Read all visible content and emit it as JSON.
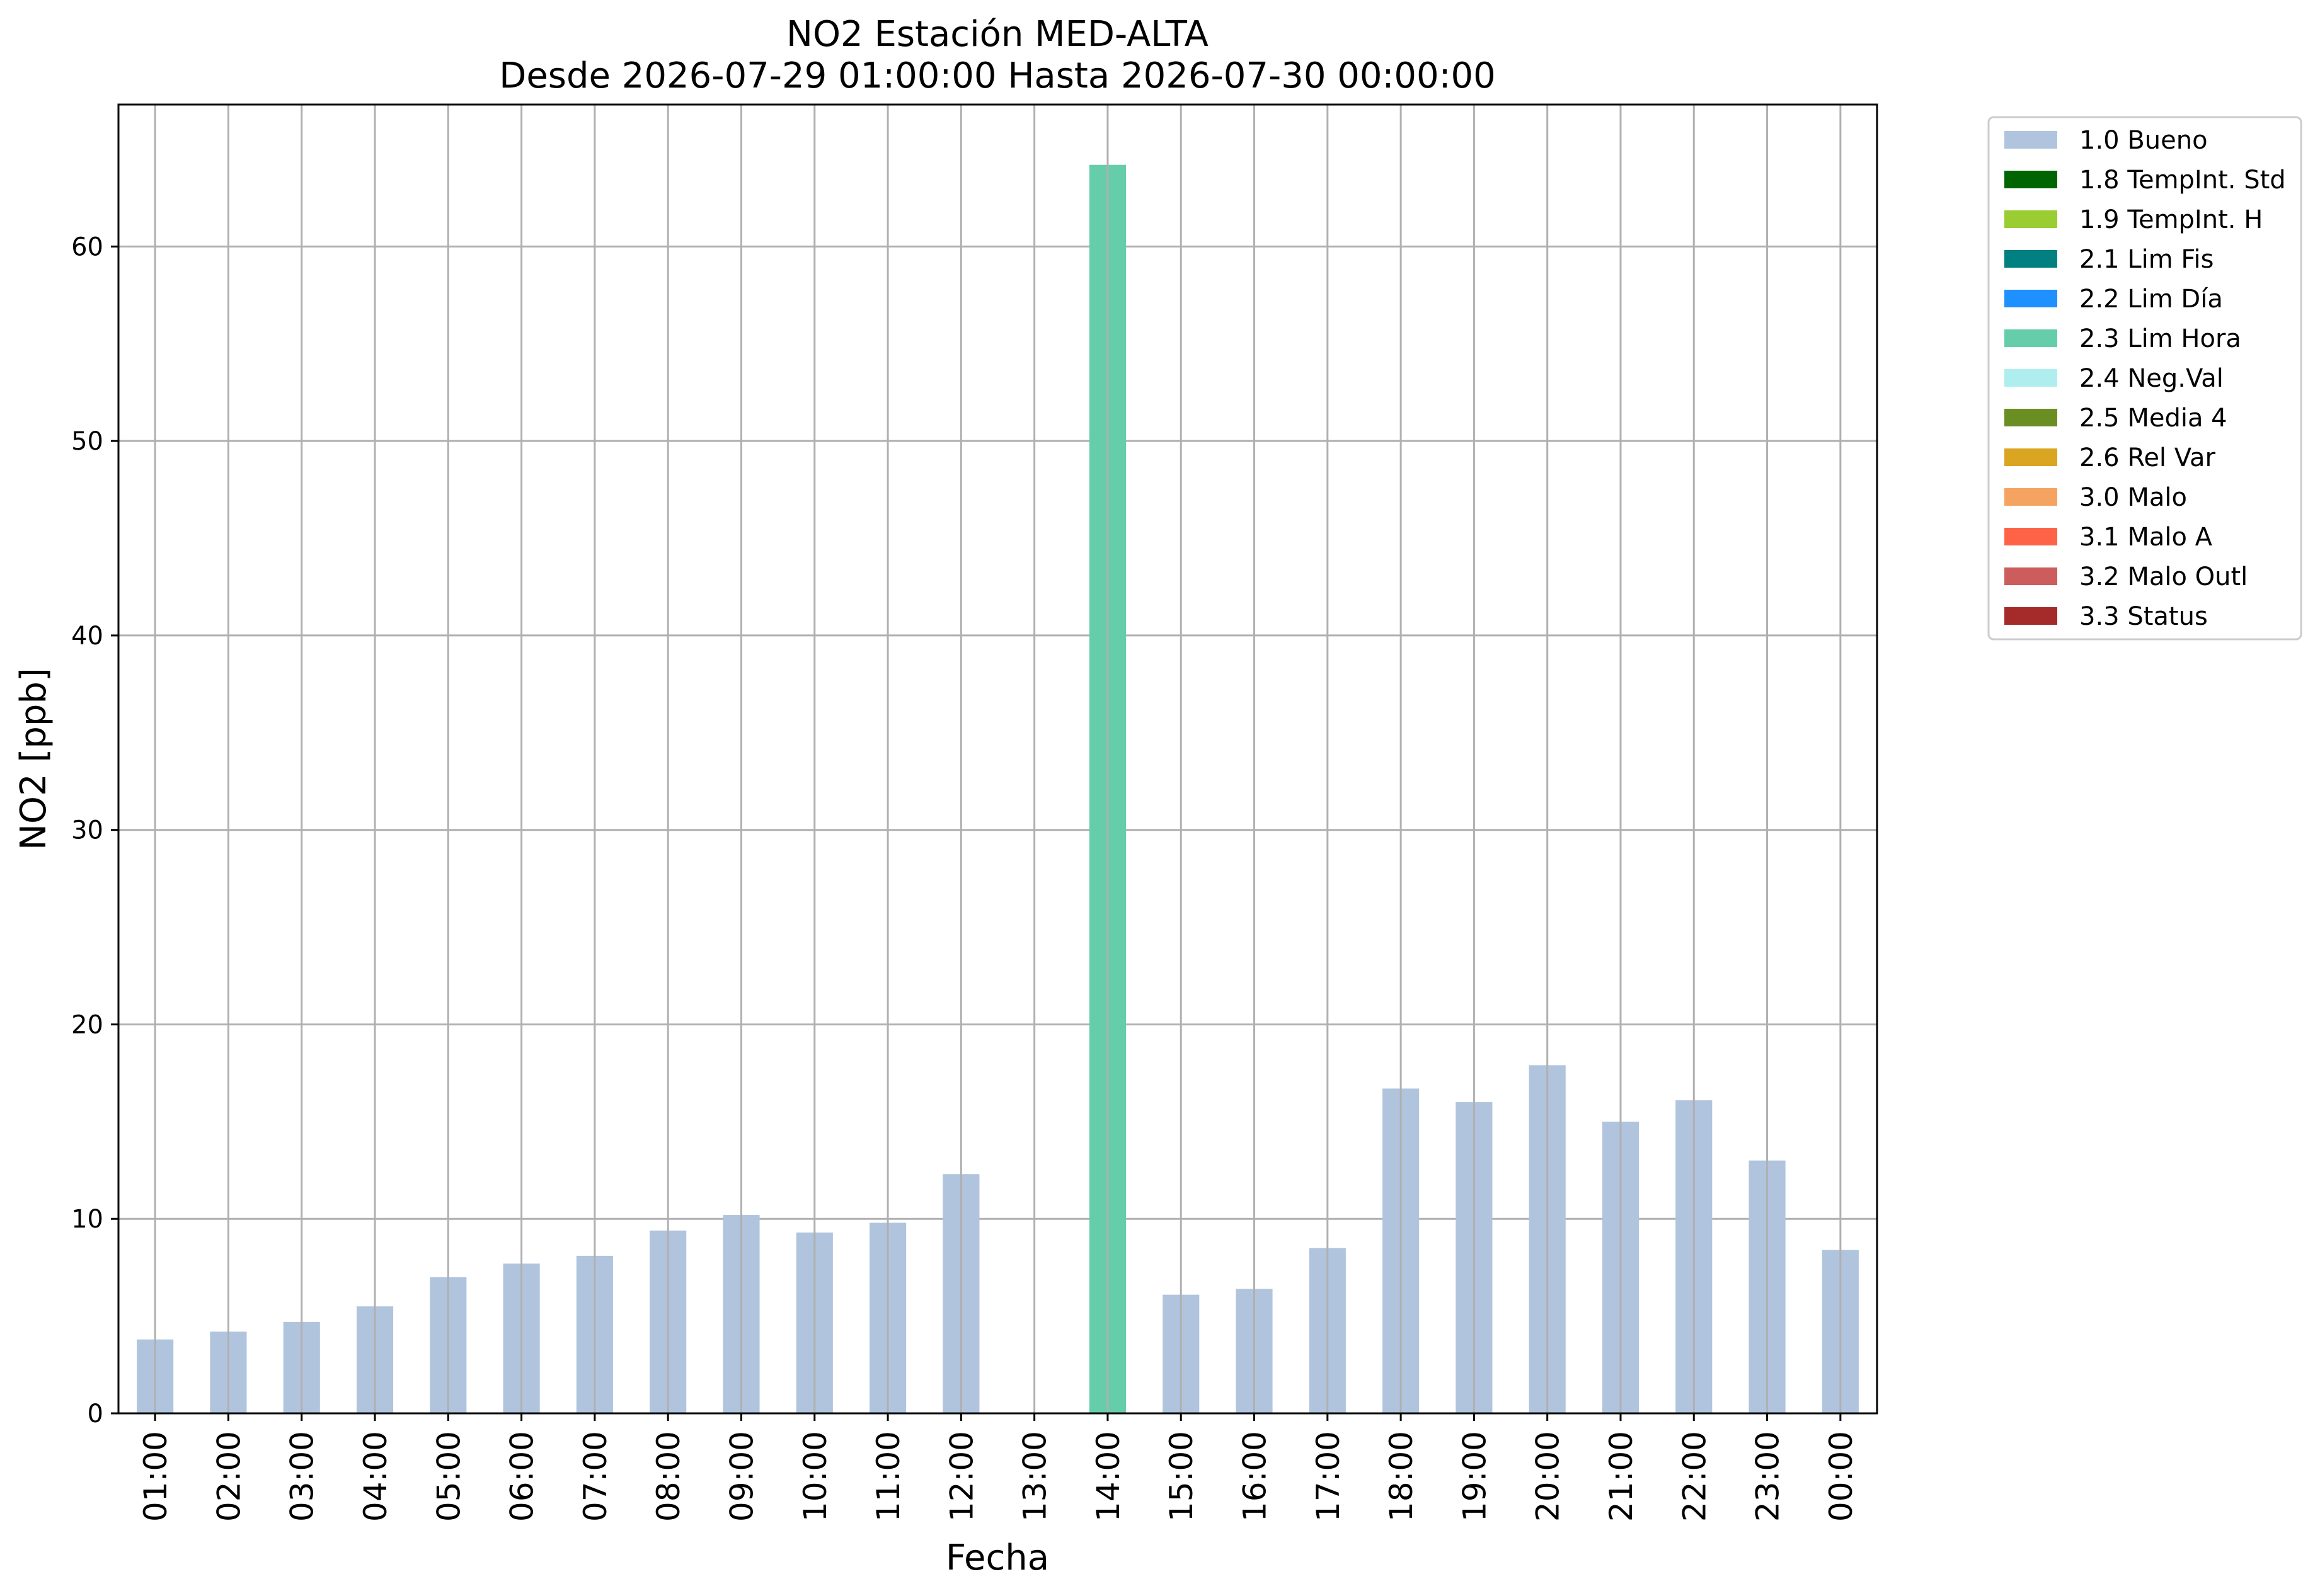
{
  "chart_data": {
    "type": "bar",
    "title": "NO2 Estación MED-ALTA",
    "subtitle": "Desde 2026-07-29 01:00:00 Hasta 2026-07-30 00:00:00",
    "xlabel": "Fecha",
    "ylabel": "NO2 [ppb]",
    "ylim": [
      0,
      67.3
    ],
    "yticks": [
      0,
      10,
      20,
      30,
      40,
      50,
      60
    ],
    "grid": true,
    "legend_position": "outside-right-top",
    "categories": [
      "01:00",
      "02:00",
      "03:00",
      "04:00",
      "05:00",
      "06:00",
      "07:00",
      "08:00",
      "09:00",
      "10:00",
      "11:00",
      "12:00",
      "13:00",
      "14:00",
      "15:00",
      "16:00",
      "17:00",
      "18:00",
      "19:00",
      "20:00",
      "21:00",
      "22:00",
      "23:00",
      "00:00"
    ],
    "values": [
      3.8,
      4.2,
      4.7,
      5.5,
      7.0,
      7.7,
      8.1,
      9.4,
      10.2,
      9.3,
      9.8,
      12.3,
      null,
      64.2,
      6.1,
      6.4,
      8.5,
      16.7,
      16.0,
      17.9,
      15.0,
      16.1,
      13.0,
      8.4
    ],
    "flags": [
      "1.0 Bueno",
      "1.0 Bueno",
      "1.0 Bueno",
      "1.0 Bueno",
      "1.0 Bueno",
      "1.0 Bueno",
      "1.0 Bueno",
      "1.0 Bueno",
      "1.0 Bueno",
      "1.0 Bueno",
      "1.0 Bueno",
      "1.0 Bueno",
      null,
      "2.3 Lim Hora",
      "1.0 Bueno",
      "1.0 Bueno",
      "1.0 Bueno",
      "1.0 Bueno",
      "1.0 Bueno",
      "1.0 Bueno",
      "1.0 Bueno",
      "1.0 Bueno",
      "1.0 Bueno",
      "1.0 Bueno"
    ],
    "legend": [
      {
        "label": "1.0 Bueno",
        "color": "#b0c4de"
      },
      {
        "label": "1.8 TempInt. Std",
        "color": "#006400"
      },
      {
        "label": "1.9 TempInt. H",
        "color": "#9acd32"
      },
      {
        "label": "2.1 Lim Fis",
        "color": "#008080"
      },
      {
        "label": "2.2 Lim Día",
        "color": "#1e90ff"
      },
      {
        "label": "2.3 Lim Hora",
        "color": "#66cdaa"
      },
      {
        "label": "2.4 Neg.Val",
        "color": "#afeeee"
      },
      {
        "label": "2.5 Media 4",
        "color": "#6b8e23"
      },
      {
        "label": "2.6 Rel Var",
        "color": "#daa520"
      },
      {
        "label": "3.0 Malo",
        "color": "#f4a460"
      },
      {
        "label": "3.1 Malo A",
        "color": "#ff6347"
      },
      {
        "label": "3.2 Malo Outl",
        "color": "#cd5c5c"
      },
      {
        "label": "3.3 Status",
        "color": "#a52a2a"
      }
    ]
  }
}
